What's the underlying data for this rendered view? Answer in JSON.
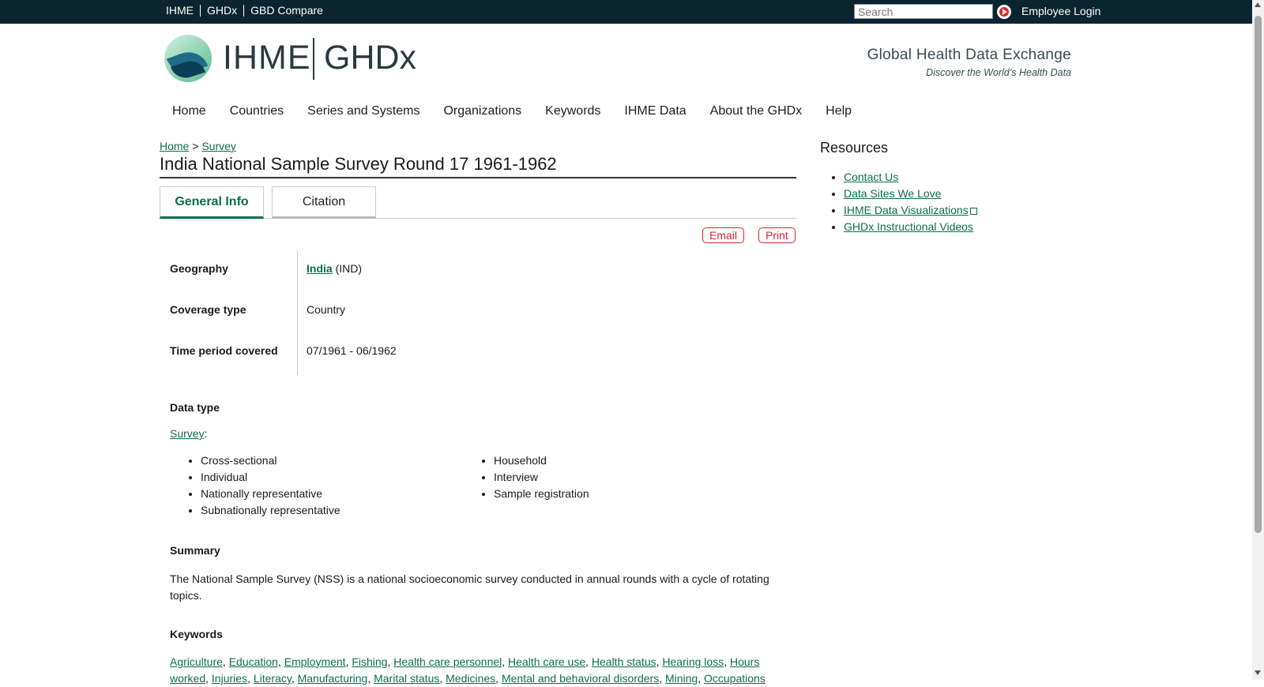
{
  "topbar": {
    "links": [
      "IHME",
      "GHDx",
      "GBD Compare"
    ],
    "search_placeholder": "Search",
    "employee_login": "Employee Login"
  },
  "header": {
    "logo_ihme": "IHME",
    "logo_ghdx": "GHDx",
    "tagline": "Global Health Data Exchange",
    "subtagline": "Discover the World’s Health Data"
  },
  "nav": [
    "Home",
    "Countries",
    "Series and Systems",
    "Organizations",
    "Keywords",
    "IHME Data",
    "About the GHDx",
    "Help"
  ],
  "breadcrumb": {
    "home": "Home",
    "sep": ">",
    "current": "Survey"
  },
  "page_title": "India National Sample Survey Round 17 1961-1962",
  "tabs": {
    "general": "General Info",
    "citation": "Citation"
  },
  "actions": {
    "email": "Email",
    "print": "Print"
  },
  "info": {
    "geography_label": "Geography",
    "geography_link": "India",
    "geography_code": "(IND)",
    "coverage_label": "Coverage type",
    "coverage_value": "Country",
    "time_label": "Time period covered",
    "time_value": "07/1961 - 06/1962"
  },
  "data_type": {
    "label": "Data type",
    "link": "Survey",
    "col1": [
      "Cross-sectional",
      "Individual",
      "Nationally representative",
      "Subnationally representative"
    ],
    "col2": [
      "Household",
      "Interview",
      "Sample registration"
    ]
  },
  "summary": {
    "label": "Summary",
    "text": "The National Sample Survey (NSS) is a national socioeconomic survey conducted in annual rounds with a cycle of rotating topics."
  },
  "keywords": {
    "label": "Keywords",
    "items": [
      "Agriculture",
      "Education",
      "Employment",
      "Fishing",
      "Health care personnel",
      "Health care use",
      "Health status",
      "Hearing loss",
      "Hours worked",
      "Injuries",
      "Literacy",
      "Manufacturing",
      "Marital status",
      "Medicines",
      "Mental and behavioral disorders",
      "Mining",
      "Occupations"
    ]
  },
  "resources": {
    "title": "Resources",
    "items": [
      "Contact Us",
      "Data Sites We Love",
      "IHME Data Visualizations",
      "GHDx Instructional Videos"
    ]
  },
  "colors": {
    "topbar_bg": "#0b2530",
    "link_green": "#0b6e4f",
    "action_red": "#d9252b"
  }
}
